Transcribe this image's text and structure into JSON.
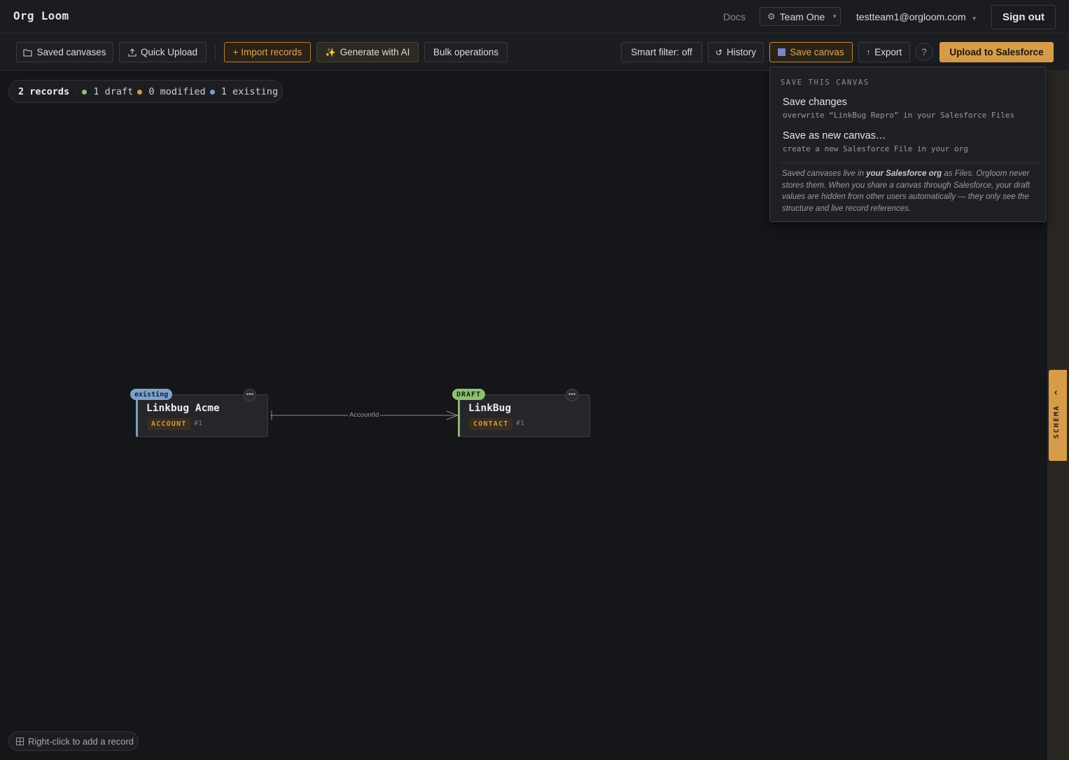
{
  "header": {
    "brand": "Org Loom",
    "docs_label": "Docs",
    "team_label": "Team One",
    "user_email": "testteam1@orgloom.com",
    "sign_out_label": "Sign out"
  },
  "toolbar": {
    "saved_canvases": "Saved canvases",
    "quick_upload": "Quick Upload",
    "import_records": "+ Import records",
    "generate_ai": "Generate with AI",
    "bulk_operations": "Bulk operations",
    "smart_filter": "Smart filter: off",
    "history": "History",
    "save_canvas": "Save canvas",
    "export": "Export",
    "help": "?",
    "upload_salesforce": "Upload to Salesforce"
  },
  "stats": {
    "records": "2 records",
    "draft": "1 draft",
    "modified": "0 modified",
    "existing": "1 existing",
    "colors": {
      "draft": "#8fc072",
      "modified": "#d69c4a",
      "existing": "#7fa2cd"
    }
  },
  "save_menu": {
    "heading": "SAVE THIS CANVAS",
    "items": [
      {
        "title": "Save changes",
        "subtitle": "overwrite “LinkBug Repro” in your Salesforce Files"
      },
      {
        "title": "Save as new canvas…",
        "subtitle": "create a new Salesforce File in your org"
      }
    ],
    "note_pre": "Saved canvases live in ",
    "note_bold": "your Salesforce org",
    "note_post": " as Files. Orgloom never stores them. When you share a canvas through Salesforce, your draft values are hidden from other users automatically — they only see the structure and live record references."
  },
  "nodes": [
    {
      "status": "existing",
      "title": "Linkbug Acme",
      "type": "ACCOUNT",
      "index": "#1"
    },
    {
      "status": "DRAFT",
      "title": "LinkBug",
      "type": "CONTACT",
      "index": "#1"
    }
  ],
  "edge": {
    "label": "AccountId"
  },
  "schema_tab": {
    "label": "SCHEMA"
  },
  "hint": {
    "label": "Right-click to add a record"
  },
  "colors": {
    "accent": "#d69c4a",
    "background": "#151619"
  }
}
